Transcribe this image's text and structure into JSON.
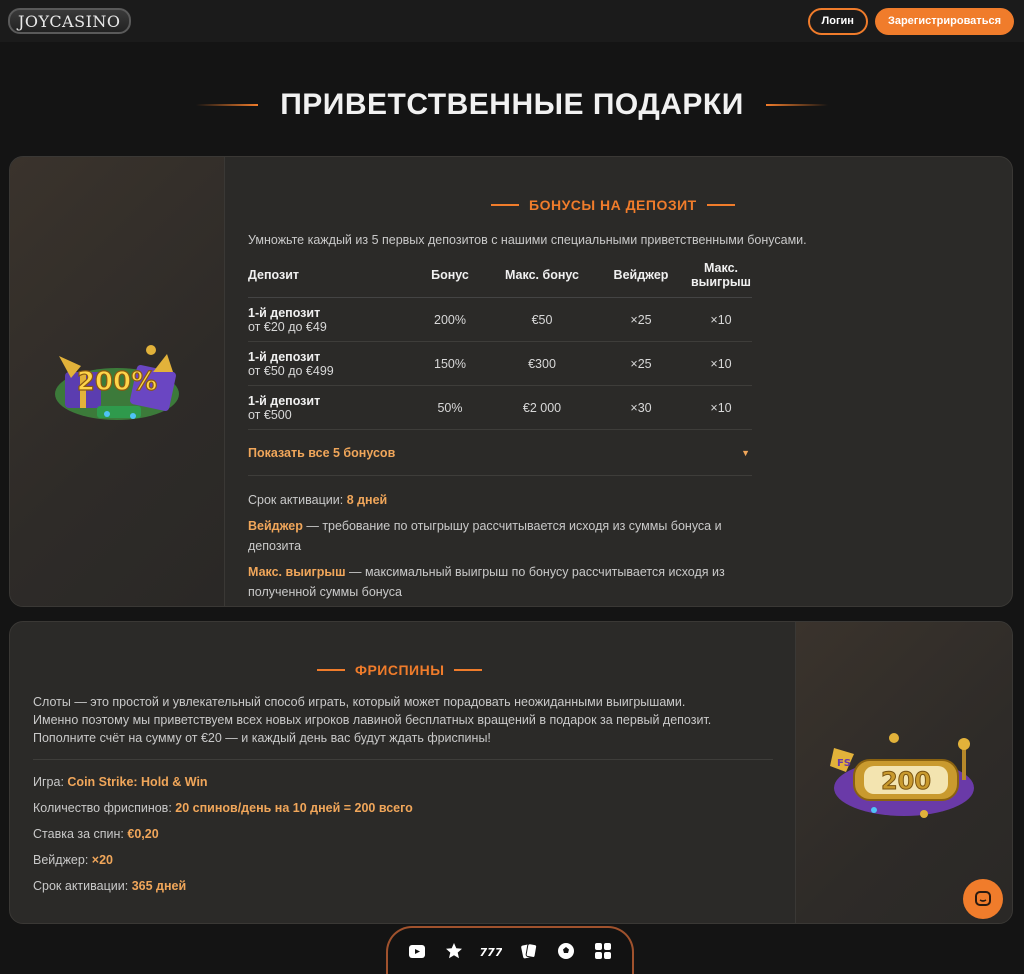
{
  "header": {
    "logo_text": "JOYCASINO",
    "login_label": "Логин",
    "register_label": "Зарегистрироваться"
  },
  "page_title": "ПРИВЕТСТВЕННЫЕ ПОДАРКИ",
  "deposit_section": {
    "title": "БОНУСЫ НА ДЕПОЗИТ",
    "intro": "Умножьте каждый из 5 первых депозитов с нашими специальными приветственными бонусами.",
    "columns": [
      "Депозит",
      "Бонус",
      "Макс. бонус",
      "Вейджер",
      "Макс. выигрыш"
    ],
    "rows": [
      {
        "name": "1-й депозит",
        "range": "от €20 до €49",
        "bonus": "200%",
        "max_bonus": "€50",
        "wager": "×25",
        "max_win": "×10"
      },
      {
        "name": "1-й депозит",
        "range": "от €50 до €499",
        "bonus": "150%",
        "max_bonus": "€300",
        "wager": "×25",
        "max_win": "×10"
      },
      {
        "name": "1-й депозит",
        "range": "от €500",
        "bonus": "50%",
        "max_bonus": "€2 000",
        "wager": "×30",
        "max_win": "×10"
      }
    ],
    "show_all_label": "Показать все 5 бонусов",
    "activation_label": "Срок активации:",
    "activation_value": "8 дней",
    "wager_term": "Вейджер",
    "wager_desc": " — требование по отыгрышу рассчитывается исходя из суммы бонуса и депозита",
    "maxwin_term": "Макс. выигрыш",
    "maxwin_desc": " — максимальный выигрыш по бонусу рассчитывается исходя из полученной суммы бонуса",
    "image_badge": "200%"
  },
  "freespins_section": {
    "title": "ФРИСПИНЫ",
    "intro_1": "Слоты — это простой и увлекательный способ играть, который может порадовать неожиданными выигрышами.",
    "intro_2": "Именно поэтому мы приветствуем всех новых игроков лавиной бесплатных вращений в подарок за первый депозит.",
    "intro_3": "Пополните счёт на сумму от €20 — и каждый день вас будут ждать фриспины!",
    "game_label": "Игра:",
    "game_value": "Coin Strike: Hold & Win",
    "count_label": "Количество фриспинов:",
    "count_value": "20 спинов/день на 10 дней = 200 всего",
    "bet_label": "Ставка за спин:",
    "bet_value": "€0,20",
    "wager_label": "Вейджер:",
    "wager_value": "×20",
    "activation_label": "Срок активации:",
    "activation_value": "365 дней",
    "image_badge_fs": "FS",
    "image_badge_num": "200"
  },
  "bottom_nav": {
    "icons": [
      "live-video-icon",
      "star-icon",
      "slots-777-icon",
      "cards-icon",
      "soccer-ball-icon",
      "grid-icon"
    ]
  },
  "colors": {
    "accent": "#f07c2b",
    "highlight": "#f0a65a",
    "card_bg": "#2b2a28",
    "page_bg": "#141414"
  }
}
